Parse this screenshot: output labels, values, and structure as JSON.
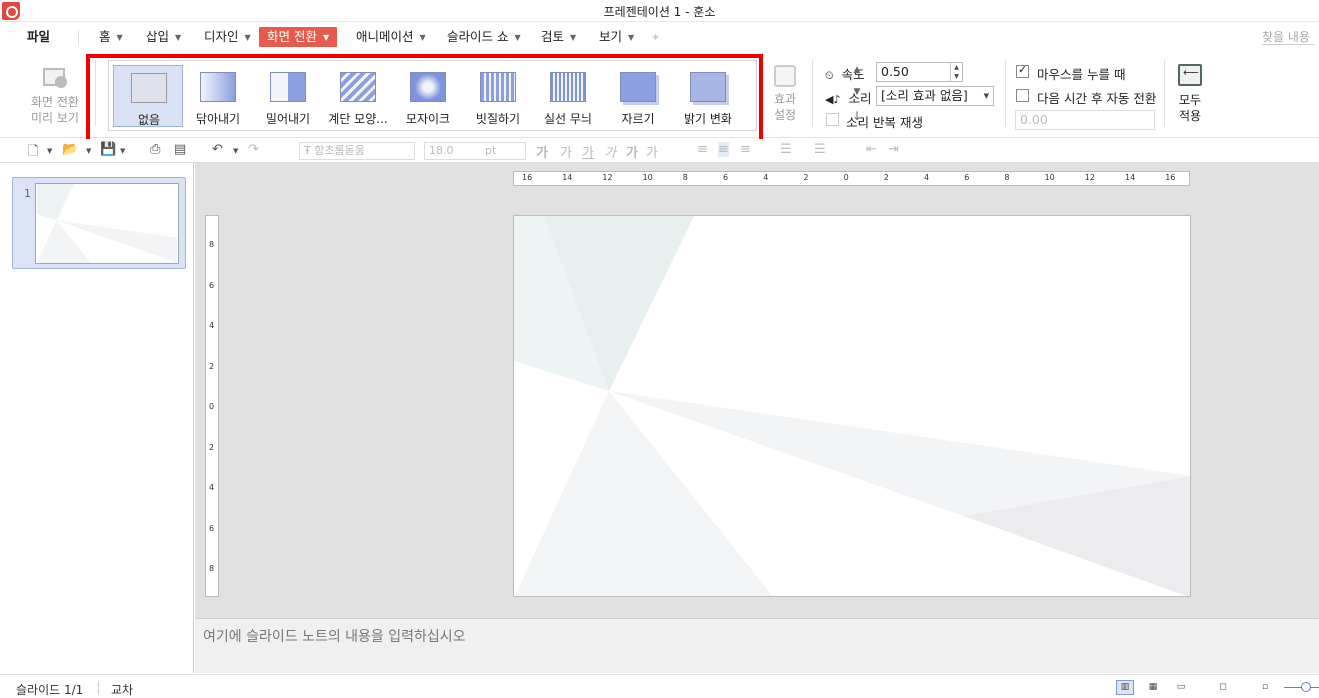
{
  "title": "프레젠테이션 1 - 훈소",
  "menu": {
    "file": "파일",
    "home": "홈",
    "insert": "삽입",
    "design": "디자인",
    "transition": "화면 전환",
    "animation": "애니메이션",
    "slideshow": "슬라이드 쇼",
    "review": "검토",
    "view": "보기",
    "search_placeholder": "찾을 내용"
  },
  "ribbon": {
    "preview_label_1": "화면 전환",
    "preview_label_2": "미리 보기",
    "transitions": [
      "없음",
      "닦아내기",
      "밀어내기",
      "계단 모양...",
      "모자이크",
      "빗질하기",
      "실선 무늬",
      "자르기",
      "밝기 변화"
    ],
    "selected_transition": "없음",
    "effect_label_1": "효과",
    "effect_label_2": "설정",
    "speed_label": "속도",
    "speed_value": "0.50",
    "sound_label": "소리",
    "sound_value": "[소리 효과 없음]",
    "repeat_sound_label": "소리 반복 재생",
    "on_click_label": "마우스를 누를 때",
    "on_click_checked": true,
    "auto_advance_label": "다음 시간 후 자동 전환",
    "auto_advance_checked": false,
    "auto_advance_value": "0.00",
    "apply_all_label_1": "모두",
    "apply_all_label_2": "적용"
  },
  "toolbar": {
    "font_name": "함초롬돋움",
    "font_size": "18.0",
    "font_unit": "pt"
  },
  "slides": {
    "thumb_number": "1"
  },
  "ruler": {
    "horizontal": [
      "16",
      "14",
      "12",
      "10",
      "8",
      "6",
      "4",
      "2",
      "0",
      "2",
      "4",
      "6",
      "8",
      "10",
      "12",
      "14",
      "16"
    ],
    "vertical": [
      "8",
      "6",
      "4",
      "2",
      "0",
      "2",
      "4",
      "6",
      "8"
    ]
  },
  "notes": {
    "placeholder": "여기에 슬라이드 노트의 내용을 입력하십시오"
  },
  "status": {
    "slide_indicator": "슬라이드 1/1",
    "theme": "교차"
  },
  "colors": {
    "accent": "#e55c4f",
    "highlight_box": "#ee0000",
    "selected_item": "#d8e2f4"
  }
}
